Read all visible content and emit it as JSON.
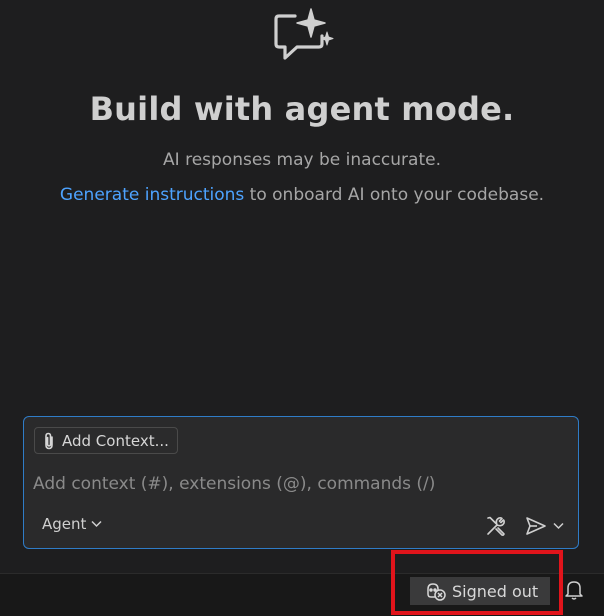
{
  "hero": {
    "icon": "chat-sparkle-icon",
    "title": "Build with agent mode.",
    "subtitle": "AI responses may be inaccurate.",
    "instructions_link": "Generate instructions",
    "instructions_rest": " to onboard AI onto your codebase."
  },
  "chat": {
    "add_context_label": "Add Context...",
    "add_context_icon": "paperclip-icon",
    "input_placeholder": "Add context (#), extensions (@), commands (/)",
    "mode_label": "Agent",
    "tools_icon": "tools-icon",
    "send_icon": "send-icon",
    "accent_border": "#2f7cc7"
  },
  "status_bar": {
    "account_label": "Signed out",
    "account_icon": "copilot-signed-out-icon",
    "notifications_icon": "bell-icon",
    "highlight_color": "#e1141b"
  },
  "colors": {
    "background": "#1e1e1f",
    "link": "#4da3ff"
  }
}
